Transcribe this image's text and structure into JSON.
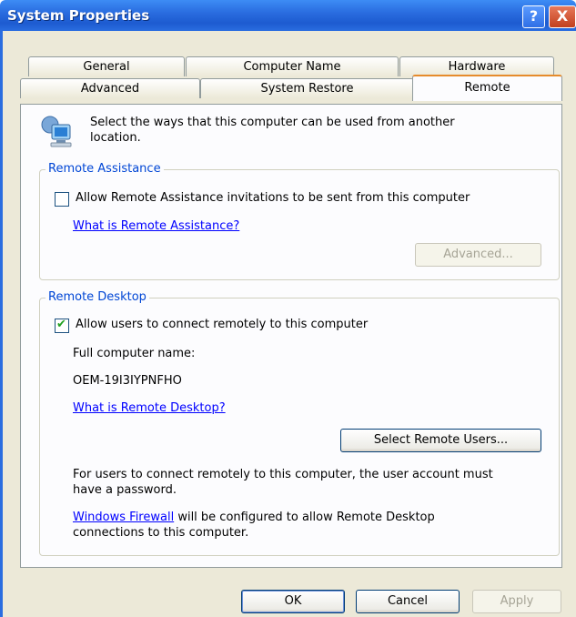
{
  "window": {
    "title": "System Properties",
    "help_glyph": "?",
    "close_glyph": "X"
  },
  "tabs_row1": [
    {
      "label": "General"
    },
    {
      "label": "Computer Name"
    },
    {
      "label": "Hardware"
    }
  ],
  "tabs_row2": [
    {
      "label": "Advanced"
    },
    {
      "label": "System Restore"
    },
    {
      "label": "Remote"
    }
  ],
  "active_tab": "Remote",
  "intro": {
    "line1": "Select the ways that this computer can be used from another",
    "line2": "location."
  },
  "remote_assistance": {
    "title": "Remote Assistance",
    "checkbox_label": "Allow Remote Assistance invitations to be sent from this computer",
    "checked": false,
    "help_link": "What is Remote Assistance?",
    "advanced_button": "Advanced..."
  },
  "remote_desktop": {
    "title": "Remote Desktop",
    "checkbox_label": "Allow users to connect remotely to this computer",
    "checked": true,
    "full_name_label": "Full computer name:",
    "computer_name": "OEM-19I3IYPNFHO",
    "help_link": "What is Remote Desktop?",
    "select_users_button": "Select Remote Users...",
    "note_line1": "For users to connect remotely to this computer, the user account must",
    "note_line2": "have a password.",
    "firewall_link": "Windows Firewall",
    "firewall_line1_rest": " will be configured to allow Remote Desktop",
    "firewall_line2": "connections to this computer."
  },
  "buttons": {
    "ok": "OK",
    "cancel": "Cancel",
    "apply": "Apply"
  }
}
